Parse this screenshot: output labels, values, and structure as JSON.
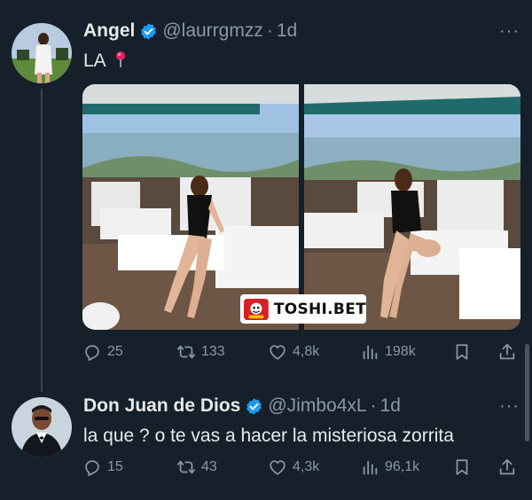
{
  "tweets": [
    {
      "author_name": "Angel",
      "handle": "@laurrgmzz",
      "separator": "·",
      "time": "1d",
      "text": "LA",
      "text_icon": "pin-icon",
      "more": "···",
      "watermark": "TOSHI.BET",
      "stats": {
        "replies": "25",
        "retweets": "133",
        "likes": "4,8k",
        "views": "198k"
      }
    },
    {
      "author_name": "Don Juan de Dios",
      "handle": "@Jimbo4xL",
      "separator": "·",
      "time": "1d",
      "text": "la que ? o te vas a hacer la misteriosa zorrita",
      "more": "···",
      "stats": {
        "replies": "15",
        "retweets": "43",
        "likes": "4,3k",
        "views": "96,1k"
      }
    }
  ],
  "colors": {
    "background": "#15202b",
    "verified": "#1d9bf0",
    "secondary_text": "#8b98a5",
    "primary_text": "#e7e9ea"
  },
  "icons": [
    "reply-icon",
    "retweet-icon",
    "like-icon",
    "views-icon",
    "bookmark-icon",
    "share-icon",
    "verified-icon"
  ]
}
